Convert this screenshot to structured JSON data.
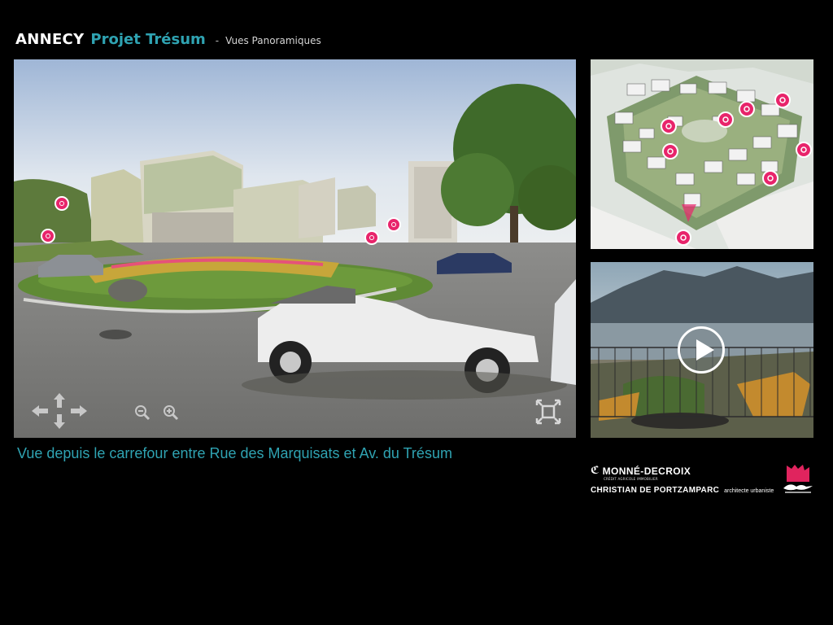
{
  "header": {
    "city": "ANNECY",
    "project": "Projet Trésum",
    "separator": "-",
    "section": "Vues Panoramiques"
  },
  "panorama": {
    "caption": "Vue depuis le carrefour entre Rue des Marquisats et Av. du Trésum",
    "controls": {
      "pan_left": "arrow-left-icon",
      "pan_up": "arrow-up-icon",
      "pan_down": "arrow-down-icon",
      "pan_right": "arrow-right-icon",
      "zoom_out": "zoom-out-icon",
      "zoom_in": "zoom-in-icon",
      "fullscreen": "fullscreen-icon"
    },
    "hotspot_color": "#e8246b"
  },
  "site_map": {
    "marker_color": "#e8246b"
  },
  "video": {
    "play_icon": "play-icon"
  },
  "logos": {
    "developer_mark": "ℭ",
    "developer": "MONNÉ-DECROIX",
    "developer_tagline": "CRÉDIT AGRICOLE IMMOBILIER",
    "architect": "CHRISTIAN DE PORTZAMPARC",
    "architect_role": "architecte urbaniste",
    "city_logo": "annecy-city-logo"
  },
  "colors": {
    "accent": "#2fa3b2",
    "background": "#000000"
  }
}
